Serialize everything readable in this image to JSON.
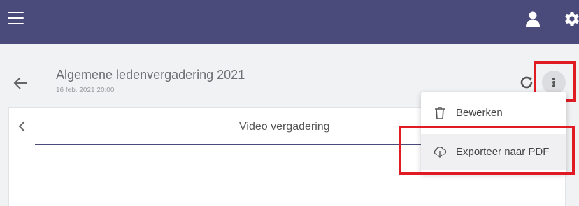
{
  "header": {
    "menu_icon": "hamburger-menu-icon",
    "user_icon": "user-icon",
    "settings_icon": "gear-icon"
  },
  "meeting": {
    "title": "Algemene ledenvergadering 2021",
    "date": "16 feb. 2021 20:00"
  },
  "tabs": {
    "active_label": "Video vergadering"
  },
  "actions_menu": {
    "items": [
      {
        "label": "Bewerken",
        "icon": "trash-icon"
      },
      {
        "label": "Exporteer naar PDF",
        "icon": "cloud-download-icon"
      }
    ]
  },
  "colors": {
    "header_bg": "#4b4b7b",
    "highlight": "#e01b24",
    "page_bg": "#f1f2f4"
  }
}
